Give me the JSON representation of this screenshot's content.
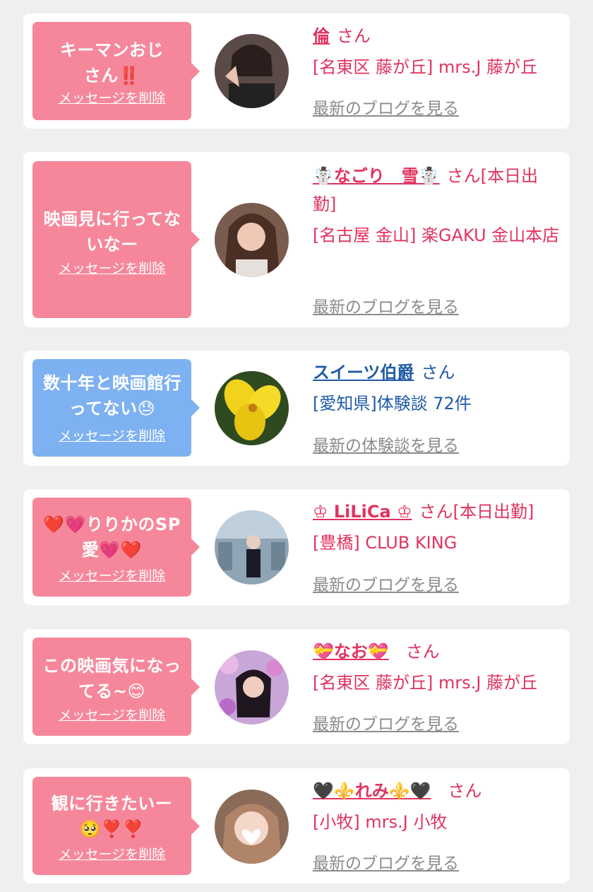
{
  "colors": {
    "page_bg": "#efefef",
    "card_bg": "#ffffff",
    "bubble_pink": "#f6879a",
    "bubble_blue": "#7eb1f1",
    "text_pink": "#e1335f",
    "text_blue": "#1f5aa6",
    "link_gray": "#8b8b8b"
  },
  "delete_label": "メッセージを削除",
  "san_label": "さん",
  "items": [
    {
      "message": "キーマンおじさん‼️",
      "name": "倫",
      "name_suffix": "",
      "detail": "[名東区 藤が丘] mrs.J 藤が丘",
      "link": "最新のブログを見る"
    },
    {
      "message": "映画見に行ってないなー",
      "name": "☃️なごり　雪☃️",
      "name_suffix": "[本日出勤]",
      "detail": "[名古屋 金山] 楽GAKU 金山本店",
      "link": "最新のブログを見る"
    },
    {
      "message": "数十年と映画館行ってない😓",
      "name": "スイーツ伯爵",
      "name_suffix": "",
      "detail": "[愛知県]体験談 72件",
      "link": "最新の体験談を見る"
    },
    {
      "message": "❤️💗りりかのSP愛💗❤️",
      "name": "♔ LiLiCa ♔",
      "name_suffix": "[本日出勤]",
      "detail": "[豊橋] CLUB KING",
      "link": "最新のブログを見る"
    },
    {
      "message": "この映画気になってる~😊",
      "name": "💝なお💝",
      "name_suffix": "",
      "detail": "[名東区 藤が丘] mrs.J 藤が丘",
      "link": "最新のブログを見る"
    },
    {
      "message": "観に行きたいー🥺❣️❣️",
      "name": "🖤⚜️れみ⚜️🖤",
      "name_suffix": "",
      "detail": "[小牧] mrs.J 小牧",
      "link": "最新のブログを見る"
    }
  ]
}
